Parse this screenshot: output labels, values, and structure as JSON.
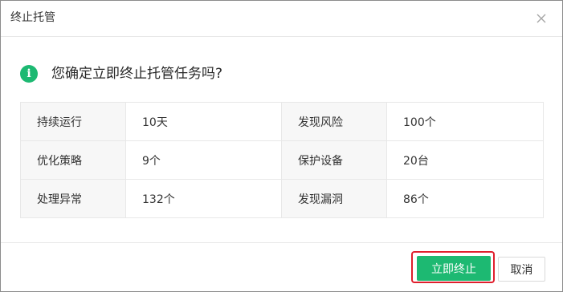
{
  "dialog": {
    "title": "终止托管",
    "close_icon": "close-icon",
    "info_icon": "info-icon",
    "info_icon_glyph": "i",
    "question": "您确定立即终止托管任务吗?",
    "accent_color": "#1db972"
  },
  "stats": {
    "rows": [
      {
        "label1": "持续运行",
        "value1": "10天",
        "label2": "发现风险",
        "value2": "100个"
      },
      {
        "label1": "优化策略",
        "value1": "9个",
        "label2": "保护设备",
        "value2": "20台"
      },
      {
        "label1": "处理异常",
        "value1": "132个",
        "label2": "发现漏洞",
        "value2": "86个"
      }
    ]
  },
  "footer": {
    "confirm_label": "立即终止",
    "cancel_label": "取消",
    "highlight_color": "#e01f2d"
  }
}
